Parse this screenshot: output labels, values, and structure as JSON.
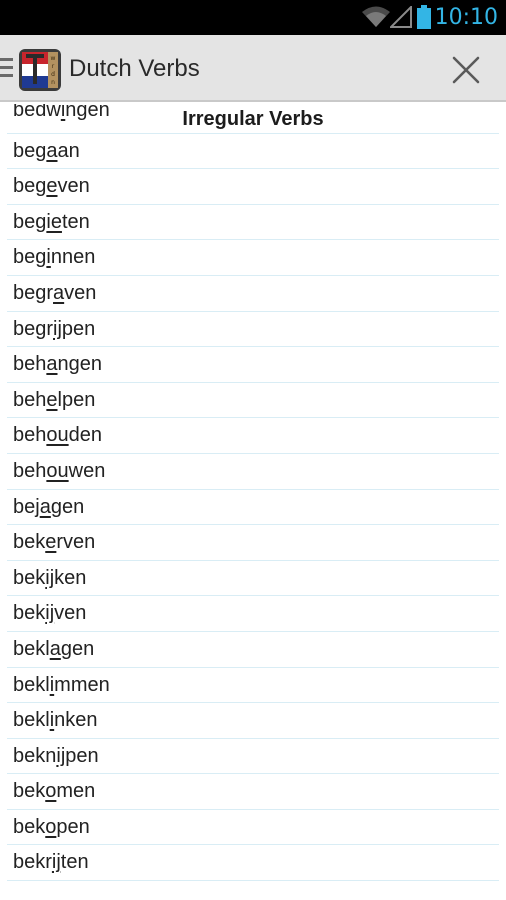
{
  "status_bar": {
    "time": "10:10",
    "accent_color": "#33b5e5",
    "icons": [
      "wifi-icon",
      "signal-icon",
      "battery-icon"
    ]
  },
  "action_bar": {
    "title": "Dutch Verbs",
    "logo_icon": "app-logo-icon",
    "close_icon": "close-icon"
  },
  "list": {
    "section_title": "Irregular Verbs",
    "items": [
      {
        "pre": "bedw",
        "u": "i",
        "post": "ngen"
      },
      {
        "pre": "beg",
        "u": "a",
        "post": "an"
      },
      {
        "pre": "beg",
        "u": "e",
        "post": "ven"
      },
      {
        "pre": "beg",
        "u": "ie",
        "post": "ten"
      },
      {
        "pre": "beg",
        "u": "i",
        "post": "nnen"
      },
      {
        "pre": "begr",
        "u": "a",
        "post": "ven"
      },
      {
        "pre": "begr",
        "u": "ij",
        "post": "pen"
      },
      {
        "pre": "beh",
        "u": "a",
        "post": "ngen"
      },
      {
        "pre": "beh",
        "u": "e",
        "post": "lpen"
      },
      {
        "pre": "beh",
        "u": "ou",
        "post": "den"
      },
      {
        "pre": "beh",
        "u": "ou",
        "post": "wen"
      },
      {
        "pre": "bej",
        "u": "a",
        "post": "gen"
      },
      {
        "pre": "bek",
        "u": "e",
        "post": "rven"
      },
      {
        "pre": "bek",
        "u": "ij",
        "post": "ken"
      },
      {
        "pre": "bek",
        "u": "ij",
        "post": "ven"
      },
      {
        "pre": "bekl",
        "u": "a",
        "post": "gen"
      },
      {
        "pre": "bekl",
        "u": "i",
        "post": "mmen"
      },
      {
        "pre": "bekl",
        "u": "i",
        "post": "nken"
      },
      {
        "pre": "bekn",
        "u": "ij",
        "post": "pen"
      },
      {
        "pre": "bek",
        "u": "o",
        "post": "men"
      },
      {
        "pre": "bek",
        "u": "o",
        "post": "pen"
      },
      {
        "pre": "bekr",
        "u": "ij",
        "post": "ten"
      }
    ]
  }
}
